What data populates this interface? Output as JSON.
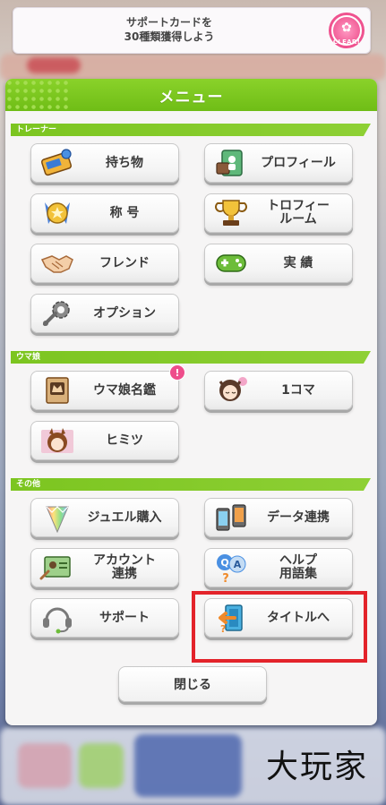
{
  "banner": {
    "text": "サポートカードを\n30種類獲得しよう",
    "badge_label": "CLEAR!",
    "badge_icon": "trophy-badge-icon"
  },
  "menu": {
    "title": "メニュー",
    "sections": {
      "trainer": "トレーナー",
      "umamusume": "ウマ娘",
      "other": "その他"
    },
    "buttons": {
      "items": "持ち物",
      "profile": "プロフィール",
      "title_badge": "称 号",
      "trophy_room": "トロフィー\nルーム",
      "friend": "フレンド",
      "achievements": "実 績",
      "options": "オプション",
      "uma_guide": "ウマ娘名鑑",
      "one_frame": "1コマ",
      "secret": "ヒミツ",
      "jewel_purchase": "ジュエル購入",
      "data_link": "データ連携",
      "account_link": "アカウント\n連携",
      "help_glossary": "ヘルプ\n用語集",
      "support": "サポート",
      "to_title": "タイトルへ"
    },
    "notification_badge": "!",
    "close_label": "閉じる"
  },
  "watermark": "大玩家",
  "colors": {
    "header_green": "#7cc520",
    "highlight_red": "#e3232a",
    "badge_pink": "#ee4d8b"
  }
}
